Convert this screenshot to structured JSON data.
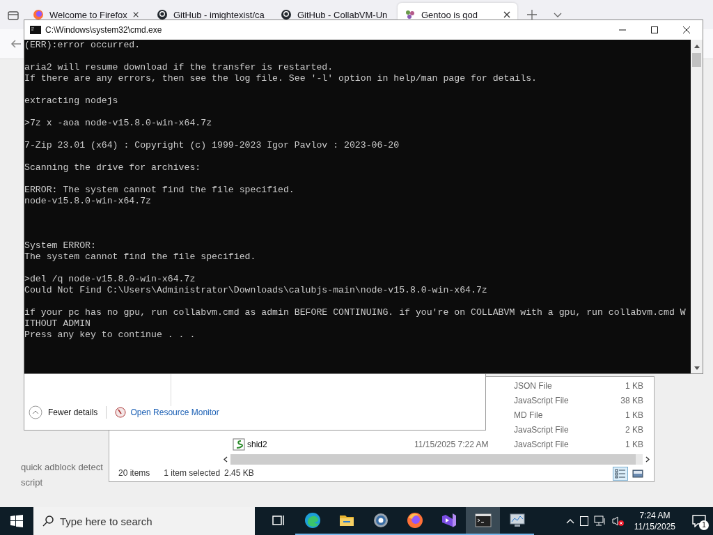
{
  "browser": {
    "tabs": [
      {
        "title": "Welcome to Firefox",
        "kind": "firefox",
        "selected": false
      },
      {
        "title": "GitHub - imightexist/ca",
        "kind": "github",
        "selected": false
      },
      {
        "title": "GitHub - CollabVM-Un",
        "kind": "github",
        "selected": false
      },
      {
        "title": "Gentoo is god",
        "kind": "gentoo",
        "selected": true
      }
    ],
    "page": {
      "lines": [
        "quick adblock detect",
        "script"
      ]
    }
  },
  "task_manager": {
    "fewer_details": "Fewer details",
    "resource_monitor_link": "Open Resource Monitor"
  },
  "explorer": {
    "rows": [
      {
        "type": "JSON File",
        "size": "1 KB"
      },
      {
        "type": "JavaScript File",
        "size": "38 KB"
      },
      {
        "type": "MD File",
        "size": "1 KB"
      },
      {
        "type": "JavaScript File",
        "size": "2 KB"
      },
      {
        "name": "shid2",
        "date": "11/15/2025 7:22 AM",
        "type": "JavaScript File",
        "size": "1 KB"
      }
    ],
    "status": {
      "count": "20 items",
      "selection": "1 item selected",
      "selection_size": "2.45 KB"
    },
    "view_buttons": [
      {
        "kind": "details",
        "selected": true
      },
      {
        "kind": "tiles",
        "selected": false
      }
    ]
  },
  "console": {
    "title": "C:\\Windows\\system32\\cmd.exe",
    "output": "(ERR):error occurred.\n\naria2 will resume download if the transfer is restarted.\nIf there are any errors, then see the log file. See '-l' option in help/man page for details.\n\nextracting nodejs\n\n>7z x -aoa node-v15.8.0-win-x64.7z\n\n7-Zip 23.01 (x64) : Copyright (c) 1999-2023 Igor Pavlov : 2023-06-20\n\nScanning the drive for archives:\n\nERROR: The system cannot find the file specified.\nnode-v15.8.0-win-x64.7z\n\n\n\nSystem ERROR:\nThe system cannot find the file specified.\n\n>del /q node-v15.8.0-win-x64.7z\nCould Not Find C:\\Users\\Administrator\\Downloads\\calubjs-main\\node-v15.8.0-win-x64.7z\n\nif your pc has no gpu, run collabvm.cmd as admin BEFORE CONTINUING. if you're on COLLABVM with a gpu, run collabvm.cmd W\nITHOUT ADMIN\nPress any key to continue . . ."
  },
  "taskbar": {
    "search_placeholder": "Type here to search",
    "apps": [
      {
        "kind": "task-view",
        "running": false,
        "selected": false
      },
      {
        "kind": "edge",
        "running": true,
        "selected": false
      },
      {
        "kind": "folder",
        "running": true,
        "selected": false
      },
      {
        "kind": "settings",
        "running": true,
        "selected": false
      },
      {
        "kind": "firefox",
        "running": true,
        "selected": false
      },
      {
        "kind": "visual-studio",
        "running": true,
        "selected": false
      },
      {
        "kind": "terminal",
        "running": true,
        "selected": true
      },
      {
        "kind": "monitor",
        "running": true,
        "selected": false
      }
    ],
    "time": "7:24 AM",
    "date": "11/15/2025",
    "notifications": "1"
  }
}
